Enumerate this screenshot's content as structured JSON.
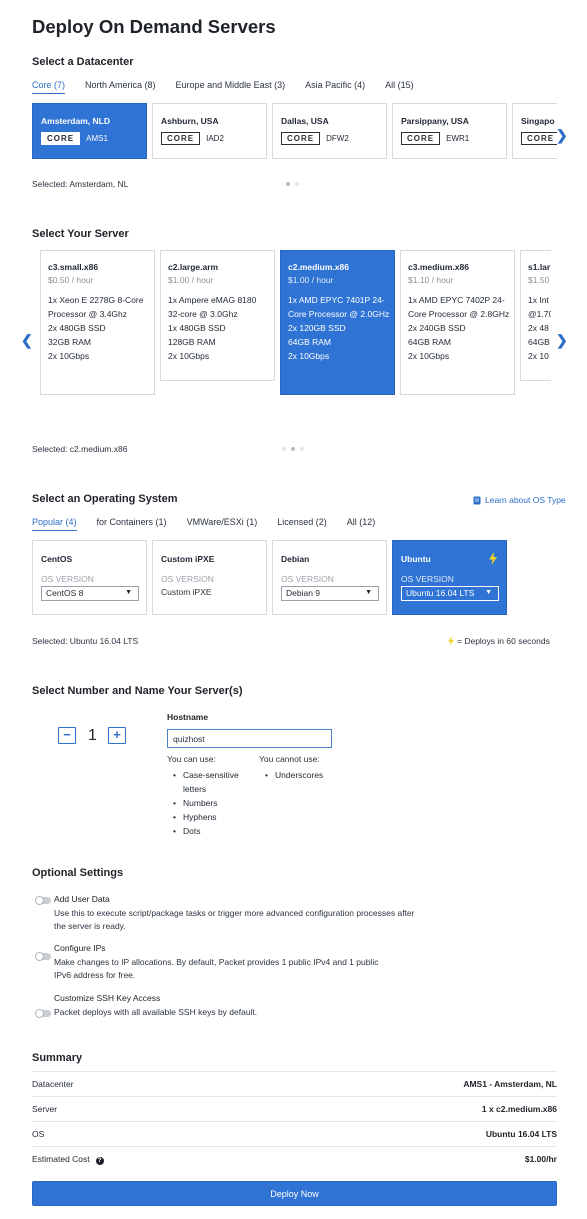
{
  "page_title": "Deploy On Demand Servers",
  "datacenter": {
    "section_title": "Select a Datacenter",
    "tabs": [
      "Core (7)",
      "North America (8)",
      "Europe and Middle East (3)",
      "Asia Pacific (4)",
      "All (15)"
    ],
    "active_tab": 0,
    "cards": [
      {
        "name": "Amsterdam, NLD",
        "badge": "CORE",
        "code": "AMS1"
      },
      {
        "name": "Ashburn, USA",
        "badge": "CORE",
        "code": "IAD2"
      },
      {
        "name": "Dallas, USA",
        "badge": "CORE",
        "code": "DFW2"
      },
      {
        "name": "Parsippany, USA",
        "badge": "CORE",
        "code": "EWR1"
      },
      {
        "name": "Singapo",
        "badge": "CORE",
        "code": ""
      }
    ],
    "selected_text": "Selected: Amsterdam, NL",
    "next_icon": "chevron-right-icon"
  },
  "server": {
    "section_title": "Select Your Server",
    "cards": [
      {
        "name": "c3.small.x86",
        "price": "$0.50 / hour",
        "specs": [
          "1x Xeon E 2278G 8-Core Processor @ 3.4Ghz",
          "2x 480GB SSD",
          "32GB RAM",
          "2x 10Gbps"
        ]
      },
      {
        "name": "c2.large.arm",
        "price": "$1.00 / hour",
        "specs": [
          "1x Ampere eMAG 8180 32-core @ 3.0Ghz",
          "1x 480GB SSD",
          "128GB RAM",
          "2x 10Gbps"
        ]
      },
      {
        "name": "c2.medium.x86",
        "price": "$1.00 / hour",
        "specs": [
          "1x AMD EPYC 7401P 24-Core Processor @ 2.0GHz",
          "2x 120GB SSD",
          "64GB RAM",
          "2x 10Gbps"
        ]
      },
      {
        "name": "c3.medium.x86",
        "price": "$1.10 / hour",
        "specs": [
          "1x AMD EPYC 7402P 24-Core Processor @ 2.8GHz",
          "2x 240GB SSD",
          "64GB RAM",
          "2x 10Gbps"
        ]
      },
      {
        "name": "s1.lar",
        "price": "$1.50",
        "specs": [
          "1x Int",
          "@1.70",
          "2x 48",
          "64GB",
          "2x 10"
        ]
      }
    ],
    "selected_text": "Selected: c2.medium.x86"
  },
  "os": {
    "section_title": "Select an Operating System",
    "learn_link": "Learn about OS Type",
    "tabs": [
      "Popular (4)",
      "for Containers (1)",
      "VMWare/ESXi (1)",
      "Licensed (2)",
      "All (12)"
    ],
    "active_tab": 0,
    "version_label": "OS VERSION",
    "cards": [
      {
        "name": "CentOS",
        "version": "CentOS 8"
      },
      {
        "name": "Custom iPXE",
        "version": "Custom iPXE"
      },
      {
        "name": "Debian",
        "version": "Debian 9"
      },
      {
        "name": "Ubuntu",
        "version": "Ubuntu 16.04 LTS"
      }
    ],
    "selected_text": "Selected: Ubuntu 16.04 LTS",
    "deploy_note": "= Deploys in 60 seconds"
  },
  "servers_count": {
    "section_title": "Select Number and Name Your Server(s)",
    "minus": "−",
    "count": "1",
    "plus": "+",
    "hostname_label": "Hostname",
    "hostname_value": "quizhost",
    "can_use_label": "You can use:",
    "can_use": [
      "Case-sensitive letters",
      "Numbers",
      "Hyphens",
      "Dots"
    ],
    "cannot_use_label": "You cannot use:",
    "cannot_use": [
      "Underscores"
    ]
  },
  "optional": {
    "section_title": "Optional Settings",
    "items": [
      {
        "title": "Add User Data",
        "desc": "Use this to execute script/package tasks or trigger more advanced configuration processes after the server is ready."
      },
      {
        "title": "Configure IPs",
        "desc": "Make changes to IP allocations. By default, Packet provides 1 public IPv4 and 1 public IPv6 address for free."
      },
      {
        "title": "Customize SSH Key Access",
        "desc": "Packet deploys with all available SSH keys by default."
      }
    ]
  },
  "summary": {
    "section_title": "Summary",
    "rows": [
      {
        "label": "Datacenter",
        "value": "AMS1 - Amsterdam, NL"
      },
      {
        "label": "Server",
        "value": "1 x c2.medium.x86"
      },
      {
        "label": "OS",
        "value": "Ubuntu 16.04 LTS"
      },
      {
        "label": "Estimated Cost",
        "value": "$1.00/hr"
      }
    ],
    "help_glyph": "?"
  },
  "deploy_button": "Deploy Now",
  "colors": {
    "accent": "#2f73d4",
    "bolt": "#f1d42b"
  }
}
